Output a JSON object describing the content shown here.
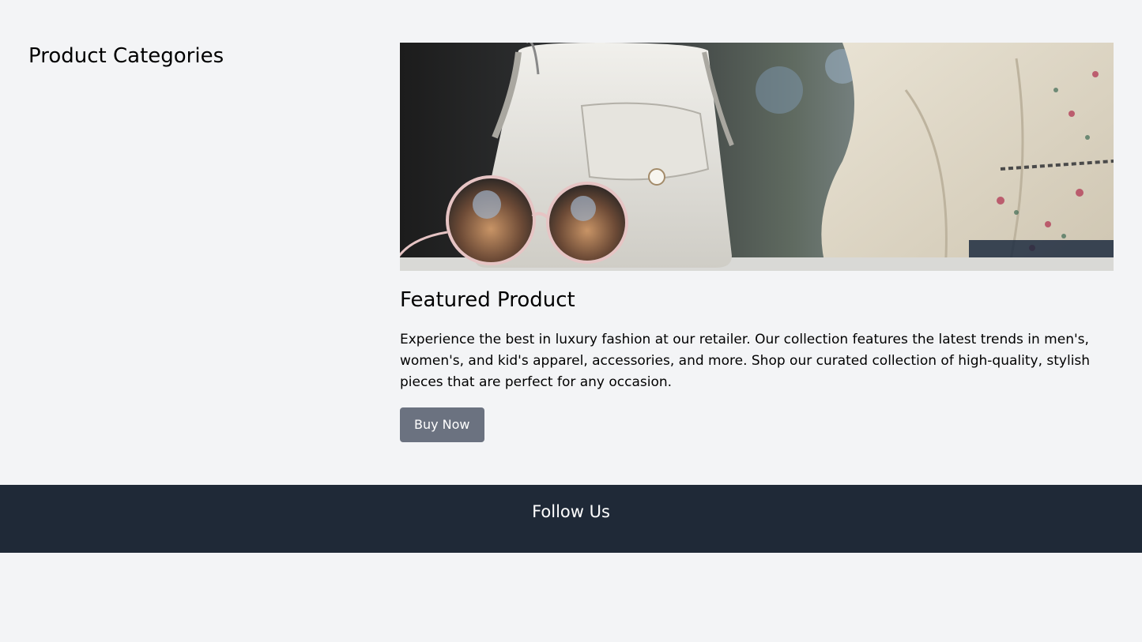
{
  "sidebar": {
    "title": "Product Categories"
  },
  "featured": {
    "image_alt": "handbag and sunglasses",
    "title": "Featured Product",
    "description": "Experience the best in luxury fashion at our retailer. Our collection features the latest trends in men's, women's, and kid's apparel, accessories, and more. Shop our curated collection of high-quality, stylish pieces that are perfect for any occasion.",
    "button_label": "Buy Now"
  },
  "footer": {
    "title": "Follow Us"
  },
  "colors": {
    "page_background": "#f3f4f6",
    "button_background": "#6b7280",
    "footer_background": "#1f2937",
    "text": "#000000",
    "footer_text": "#ffffff"
  }
}
